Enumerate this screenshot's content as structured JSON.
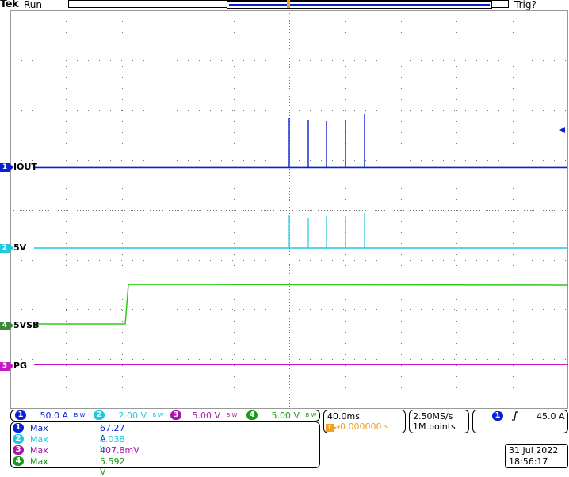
{
  "header": {
    "brand": "Tek",
    "state": "Run",
    "trigger_status": "Trig?"
  },
  "channels": [
    {
      "num": "1",
      "label": "IOUT",
      "color": "#0a1fd6"
    },
    {
      "num": "2",
      "label": "5V",
      "color": "#1ec8e0"
    },
    {
      "num": "3",
      "label": "PG",
      "color": "#c815c8"
    },
    {
      "num": "4",
      "label": "5VSB",
      "color": "#2ec81a"
    }
  ],
  "ch4_marker_color": "#3a8a3a",
  "scales": [
    {
      "num": "1",
      "value": "50.0 A",
      "color": "#0a1fd6"
    },
    {
      "num": "2",
      "value": "2.00 V",
      "color": "#1ec8e0"
    },
    {
      "num": "3",
      "value": "5.00 V",
      "color": "#a815a8"
    },
    {
      "num": "4",
      "value": "5.00 V",
      "color": "#1a9a1a"
    }
  ],
  "bw_label": "B W",
  "measurements": [
    {
      "num": "1",
      "name": "Max",
      "value": "67.27 A",
      "color": "#0a1fd6"
    },
    {
      "num": "2",
      "name": "Max",
      "value": "2.038 V",
      "color": "#1ec8e0"
    },
    {
      "num": "3",
      "name": "Max",
      "value": "407.8mV",
      "color": "#a815a8"
    },
    {
      "num": "4",
      "name": "Max",
      "value": "5.592 V",
      "color": "#1a9a1a"
    }
  ],
  "timebase": {
    "per_div": "40.0ms",
    "delay": "0.000000 s",
    "trigger_pos_icon": "T"
  },
  "acquisition": {
    "sample_rate": "2.50MS/s",
    "record_length": "1M points"
  },
  "trigger": {
    "source": "1",
    "slope_icon": "rising-edge-icon",
    "level": "45.0 A"
  },
  "datetime": {
    "date": "31 Jul  2022",
    "time": "18:56:17"
  },
  "colors": {
    "trigger": "#f0a020"
  }
}
